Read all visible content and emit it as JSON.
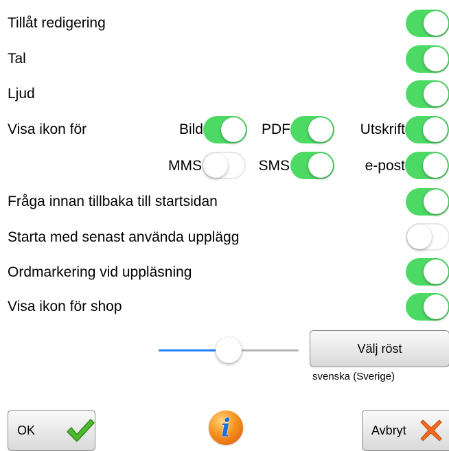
{
  "settings": {
    "allow_edit": {
      "label": "Tillåt redigering",
      "on": true
    },
    "speech": {
      "label": "Tal",
      "on": true
    },
    "sound": {
      "label": "Ljud",
      "on": true
    },
    "show_icon_for": {
      "label": "Visa ikon för",
      "image": {
        "label": "Bild",
        "on": true
      },
      "pdf": {
        "label": "PDF",
        "on": true
      },
      "print": {
        "label": "Utskrift",
        "on": true
      },
      "mms": {
        "label": "MMS",
        "on": false
      },
      "sms": {
        "label": "SMS",
        "on": true
      },
      "email": {
        "label": "e-post",
        "on": true
      }
    },
    "ask_before_home": {
      "label": "Fråga innan tillbaka till startsidan",
      "on": true
    },
    "start_last_layout": {
      "label": "Starta med senast använda upplägg",
      "on": false
    },
    "word_highlight": {
      "label": "Ordmarkering vid uppläsning",
      "on": true
    },
    "show_shop_icon": {
      "label": "Visa ikon för shop",
      "on": true
    }
  },
  "voice": {
    "speed_fraction": 0.5,
    "choose_label": "Välj röst",
    "language": "svenska (Sverige)"
  },
  "footer": {
    "ok_label": "OK",
    "cancel_label": "Avbryt",
    "ok_icon": "checkmark-icon",
    "cancel_icon": "close-x-icon",
    "info_icon": "info-icon"
  },
  "colors": {
    "toggle_on": "#4cd964",
    "slider_fill": "#1a82fb",
    "ok_check": "#4cba2e",
    "cancel_x": "#f26a21"
  }
}
